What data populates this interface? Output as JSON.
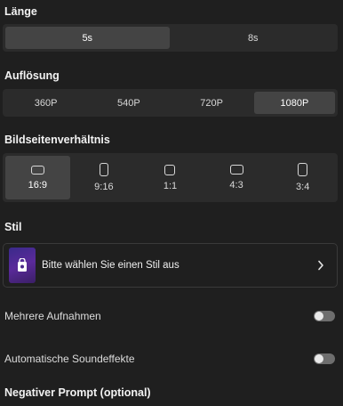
{
  "laenge": {
    "label": "Länge",
    "options": [
      {
        "label": "5s",
        "selected": true
      },
      {
        "label": "8s",
        "selected": false
      }
    ]
  },
  "aufloesung": {
    "label": "Auflösung",
    "options": [
      {
        "label": "360P",
        "selected": false
      },
      {
        "label": "540P",
        "selected": false
      },
      {
        "label": "720P",
        "selected": false
      },
      {
        "label": "1080P",
        "selected": true
      }
    ]
  },
  "seitenverhaeltnis": {
    "label": "Bildseitenverhältnis",
    "options": [
      {
        "label": "16:9",
        "selected": true
      },
      {
        "label": "9:16",
        "selected": false
      },
      {
        "label": "1:1",
        "selected": false
      },
      {
        "label": "4:3",
        "selected": false
      },
      {
        "label": "3:4",
        "selected": false
      }
    ]
  },
  "stil": {
    "label": "Stil",
    "placeholder": "Bitte wählen Sie einen Stil aus",
    "thumb_icon": "style-bag-icon",
    "chevron_icon": "chevron-right-icon"
  },
  "toggles": {
    "multi_shot": {
      "label": "Mehrere Aufnahmen",
      "on": false
    },
    "auto_sfx": {
      "label": "Automatische Soundeffekte",
      "on": false
    }
  },
  "negative_prompt": {
    "label": "Negativer Prompt (optional)"
  },
  "colors": {
    "background": "#1f1f1f",
    "segment_bg": "#2b2b2b",
    "segment_active": "#444444",
    "toggle_track": "#6e6e6e",
    "thumb_purple": "#5a2a9a"
  }
}
